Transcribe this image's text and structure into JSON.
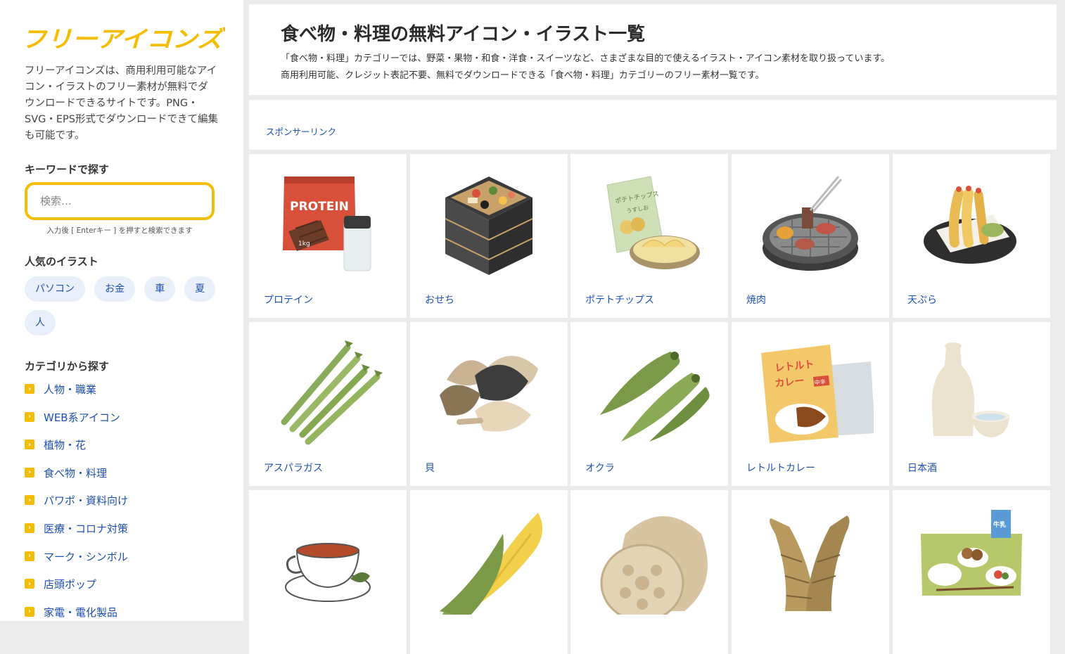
{
  "sidebar": {
    "logo_text": "フリーアイコンズ",
    "description": "フリーアイコンズは、商用利用可能なアイコン・イラストのフリー素材が無料でダウンロードできるサイトです。PNG・SVG・EPS形式でダウンロードできて編集も可能です。",
    "keyword_heading": "キーワードで探す",
    "search_placeholder": "検索…",
    "search_hint": "入力後 [ Enterキー ] を押すと検索できます",
    "popular_heading": "人気のイラスト",
    "popular_tags": [
      "パソコン",
      "お金",
      "車",
      "夏",
      "人"
    ],
    "category_heading": "カテゴリから探す",
    "categories": [
      "人物・職業",
      "WEB系アイコン",
      "植物・花",
      "食べ物・料理",
      "パワポ・資料向け",
      "医療・コロナ対策",
      "マーク・シンボル",
      "店頭ポップ",
      "家電・電化製品"
    ]
  },
  "header": {
    "title": "食べ物・料理の無料アイコン・イラスト一覧",
    "lead_1": "「食べ物・料理」カテゴリーでは、野菜・果物・和食・洋食・スイーツなど、さまざまな目的で使えるイラスト・アイコン素材を取り扱っています。",
    "lead_2": "商用利用可能、クレジット表記不要、無料でダウンロードできる「食べ物・料理」カテゴリーのフリー素材一覧です。"
  },
  "sponsor": {
    "label": "スポンサーリンク"
  },
  "items": [
    {
      "name": "プロテイン",
      "icon": "protein-icon"
    },
    {
      "name": "おせち",
      "icon": "osechi-icon"
    },
    {
      "name": "ポテトチップス",
      "icon": "potato-chips-icon"
    },
    {
      "name": "焼肉",
      "icon": "yakiniku-icon"
    },
    {
      "name": "天ぷら",
      "icon": "tempura-icon"
    },
    {
      "name": "アスパラガス",
      "icon": "asparagus-icon"
    },
    {
      "name": "貝",
      "icon": "shellfish-icon"
    },
    {
      "name": "オクラ",
      "icon": "okra-icon"
    },
    {
      "name": "レトルトカレー",
      "icon": "retort-curry-icon"
    },
    {
      "name": "日本酒",
      "icon": "sake-icon"
    },
    {
      "name": "",
      "icon": "tea-cup-icon"
    },
    {
      "name": "",
      "icon": "corn-icon"
    },
    {
      "name": "",
      "icon": "lotus-root-icon"
    },
    {
      "name": "",
      "icon": "bamboo-shoot-icon"
    },
    {
      "name": "",
      "icon": "school-lunch-icon"
    }
  ],
  "product_text": {
    "protein_label": "PROTEIN",
    "protein_weight": "1kg",
    "chips_label": "ポテトチップス",
    "chips_flavor": "うすしお",
    "curry_label_1": "レトルト",
    "curry_label_2": "カレー",
    "curry_heat": "中辛",
    "milk_label": "牛乳"
  },
  "colors": {
    "accent": "#f5bd00",
    "link": "#1f4fb2",
    "tag_bg": "#e9f0fb",
    "page_bg": "#ececec"
  }
}
